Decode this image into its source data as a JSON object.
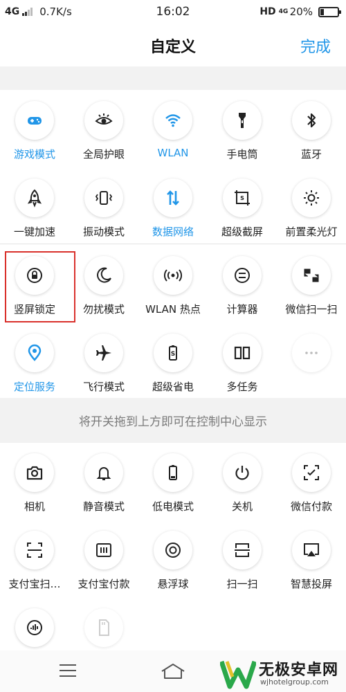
{
  "status_bar": {
    "network": "4G",
    "speed": "0.7K/s",
    "time": "16:02",
    "hd": "HD",
    "network_right": "4G",
    "battery_percent": "20%",
    "battery_level": 0.2
  },
  "header": {
    "title": "自定义",
    "done_label": "完成"
  },
  "colors": {
    "accent": "#2196e8",
    "highlight": "#d9302b",
    "band": "#f2f2f2"
  },
  "active_tiles": [
    {
      "label": "游戏模式",
      "icon": "gamepad-icon",
      "active": true
    },
    {
      "label": "全局护眼",
      "icon": "eye-icon",
      "active": false
    },
    {
      "label": "WLAN",
      "icon": "wifi-icon",
      "active": true
    },
    {
      "label": "手电筒",
      "icon": "flashlight-icon",
      "active": false
    },
    {
      "label": "蓝牙",
      "icon": "bluetooth-icon",
      "active": false
    },
    {
      "label": "一键加速",
      "icon": "rocket-icon",
      "active": false
    },
    {
      "label": "振动模式",
      "icon": "vibrate-icon",
      "active": false
    },
    {
      "label": "数据网络",
      "icon": "data-arrows-icon",
      "active": true
    },
    {
      "label": "超级截屏",
      "icon": "screenshot-icon",
      "active": false
    },
    {
      "label": "前置柔光灯",
      "icon": "sun-icon",
      "active": false
    },
    {
      "label": "竖屏锁定",
      "icon": "rotation-lock-icon",
      "active": false
    },
    {
      "label": "勿扰模式",
      "icon": "moon-icon",
      "active": false
    },
    {
      "label": "WLAN 热点",
      "icon": "hotspot-icon",
      "active": false
    },
    {
      "label": "计算器",
      "icon": "calculator-icon",
      "active": false
    },
    {
      "label": "微信扫一扫",
      "icon": "wechat-scan-icon",
      "active": false
    },
    {
      "label": "定位服务",
      "icon": "location-icon",
      "active": true
    },
    {
      "label": "飞行模式",
      "icon": "airplane-icon",
      "active": false
    },
    {
      "label": "超级省电",
      "icon": "battery-saver-icon",
      "active": false
    },
    {
      "label": "多任务",
      "icon": "multitask-icon",
      "active": false
    },
    {
      "label": "",
      "icon": "more-icon",
      "active": false
    }
  ],
  "hint_text": "将开关拖到上方即可在控制中心显示",
  "inactive_tiles": [
    {
      "label": "相机",
      "icon": "camera-icon"
    },
    {
      "label": "静音模式",
      "icon": "bell-icon"
    },
    {
      "label": "低电模式",
      "icon": "low-battery-icon"
    },
    {
      "label": "关机",
      "icon": "power-icon"
    },
    {
      "label": "微信付款",
      "icon": "wechat-pay-icon"
    },
    {
      "label": "支付宝扫…",
      "icon": "alipay-scan-icon"
    },
    {
      "label": "支付宝付款",
      "icon": "alipay-pay-icon"
    },
    {
      "label": "悬浮球",
      "icon": "float-ball-icon"
    },
    {
      "label": "扫一扫",
      "icon": "scan-icon"
    },
    {
      "label": "智慧投屏",
      "icon": "screen-cast-icon"
    },
    {
      "label": "",
      "icon": "voice-icon"
    },
    {
      "label": "",
      "icon": "sd-card-icon"
    }
  ],
  "watermark": {
    "name": "无极安卓网",
    "url": "wjhotelgroup.com"
  }
}
